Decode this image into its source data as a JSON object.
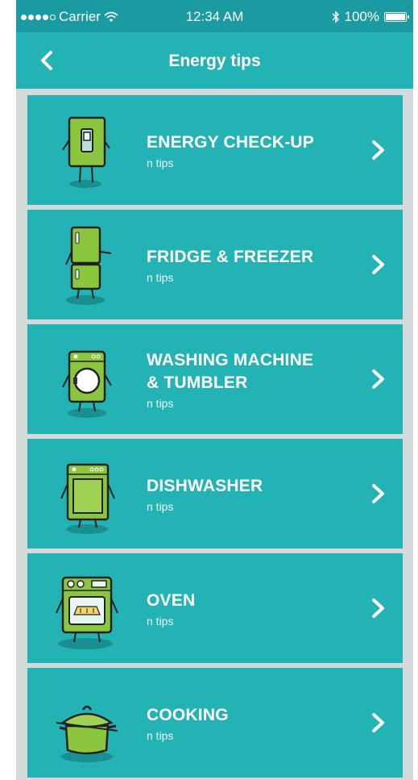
{
  "status_bar": {
    "carrier": "Carrier",
    "time": "12:34 AM",
    "battery": "100%"
  },
  "nav": {
    "title": "Energy tips",
    "back_icon": "chevron-left-icon"
  },
  "colors": {
    "status_bar_bg": "#1a9ba1",
    "nav_bg": "#24b3b4",
    "row_bg": "#24b3b4",
    "list_bg": "#d4dadb",
    "appliance_green": "#8cc63e"
  },
  "items": [
    {
      "label": "ENERGY CHECK-UP",
      "sub": "n tips",
      "icon": "light-switch-icon"
    },
    {
      "label": "FRIDGE & FREEZER",
      "sub": "n tips",
      "icon": "fridge-icon"
    },
    {
      "label": "WASHING MACHINE\n& TUMBLER",
      "sub": "n tips",
      "icon": "washing-machine-icon"
    },
    {
      "label": "DISHWASHER",
      "sub": "n tips",
      "icon": "dishwasher-icon"
    },
    {
      "label": "OVEN",
      "sub": "n tips",
      "icon": "oven-icon"
    },
    {
      "label": "COOKING",
      "sub": "n tips",
      "icon": "cooking-pot-icon"
    }
  ]
}
